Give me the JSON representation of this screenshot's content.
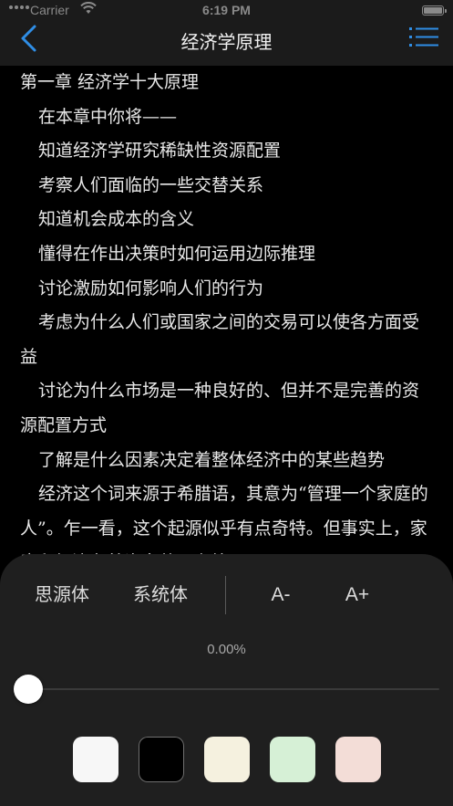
{
  "status": {
    "carrier": "Carrier",
    "time": "6:19 PM"
  },
  "nav": {
    "title": "经济学原理",
    "back_icon": "chevron-left-icon",
    "menu_icon": "list-icon",
    "accent": "#2f8ee6"
  },
  "content": {
    "paragraphs": [
      "第一章 经济学十大原理",
      "在本章中你将——",
      "知道经济学研究稀缺性资源配置",
      "考察人们面临的一些交替关系",
      "知道机会成本的含义",
      "懂得在作出决策时如何运用边际推理",
      "讨论激励如何影响人们的行为",
      "考虑为什么人们或国家之间的交易可以使各方面受益",
      "讨论为什么市场是一种良好的、但并不是完善的资源配置方式",
      "了解是什么因素决定着整体经济中的某些趋势",
      "经济这个词来源于希腊语，其意为“管理一个家庭的人”。乍一看，这个起源似乎有点奇特。但事实上，家庭和经济有着许多共同之处。"
    ]
  },
  "panel": {
    "font_siyuan": "思源体",
    "font_system": "系统体",
    "size_decrease": "A-",
    "size_increase": "A+",
    "progress_text": "0.00%",
    "progress_value": 0,
    "themes": [
      {
        "name": "white",
        "color": "#f7f7f7",
        "selected": false
      },
      {
        "name": "black",
        "color": "#000000",
        "selected": true
      },
      {
        "name": "cream",
        "color": "#f5f1df",
        "selected": false
      },
      {
        "name": "green",
        "color": "#d6f0d6",
        "selected": false
      },
      {
        "name": "pink",
        "color": "#f3ddd7",
        "selected": false
      }
    ]
  }
}
